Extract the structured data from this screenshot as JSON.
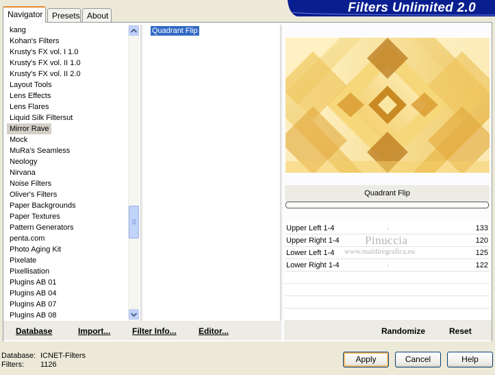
{
  "header": {
    "title": "Filters Unlimited 2.0"
  },
  "tabs": [
    {
      "label": "Navigator",
      "active": true
    },
    {
      "label": "Presets",
      "active": false
    },
    {
      "label": "About",
      "active": false
    }
  ],
  "categories": {
    "items": [
      "kang",
      "Kohan's Filters",
      "Krusty's FX vol. I 1.0",
      "Krusty's FX vol. II 1.0",
      "Krusty's FX vol. II 2.0",
      "Layout Tools",
      "Lens Effects",
      "Lens Flares",
      "Liquid Silk Filtersut",
      "Mirror Rave",
      "Mock",
      "MuRa's Seamless",
      "Neology",
      "Nirvana",
      "Noise Filters",
      "Oliver's Filters",
      "Paper Backgrounds",
      "Paper Textures",
      "Pattern Generators",
      "penta.com",
      "Photo Aging Kit",
      "Pixelate",
      "Pixellisation",
      "Plugins AB 01",
      "Plugins AB 04",
      "Plugins AB 07",
      "Plugins AB 08"
    ],
    "selected": "Mirror Rave"
  },
  "filters": {
    "items": [
      "Quadrant Flip"
    ],
    "selected": "Quadrant Flip"
  },
  "preview": {
    "caption": "Quadrant Flip"
  },
  "params": [
    {
      "label": "Upper Left 1-4",
      "value": "133"
    },
    {
      "label": "Upper Right 1-4",
      "value": "120"
    },
    {
      "label": "Lower Left 1-4",
      "value": "125"
    },
    {
      "label": "Lower Right 1-4",
      "value": "122"
    }
  ],
  "watermark": {
    "line1": "Pinuccia",
    "line2": "www.maidiregrafica.eu"
  },
  "buttons": {
    "database": "Database",
    "import": "Import...",
    "filter_info": "Filter Info...",
    "editor": "Editor...",
    "randomize": "Randomize",
    "reset": "Reset",
    "apply": "Apply",
    "cancel": "Cancel",
    "help": "Help"
  },
  "status": {
    "database_label": "Database:",
    "database_value": "ICNET-Filters",
    "filters_label": "Filters:",
    "filters_value": "1126"
  },
  "colors": {
    "banner": "#0a1f8f",
    "selection": "#316ac5",
    "tab_accent": "#e68b2c"
  }
}
